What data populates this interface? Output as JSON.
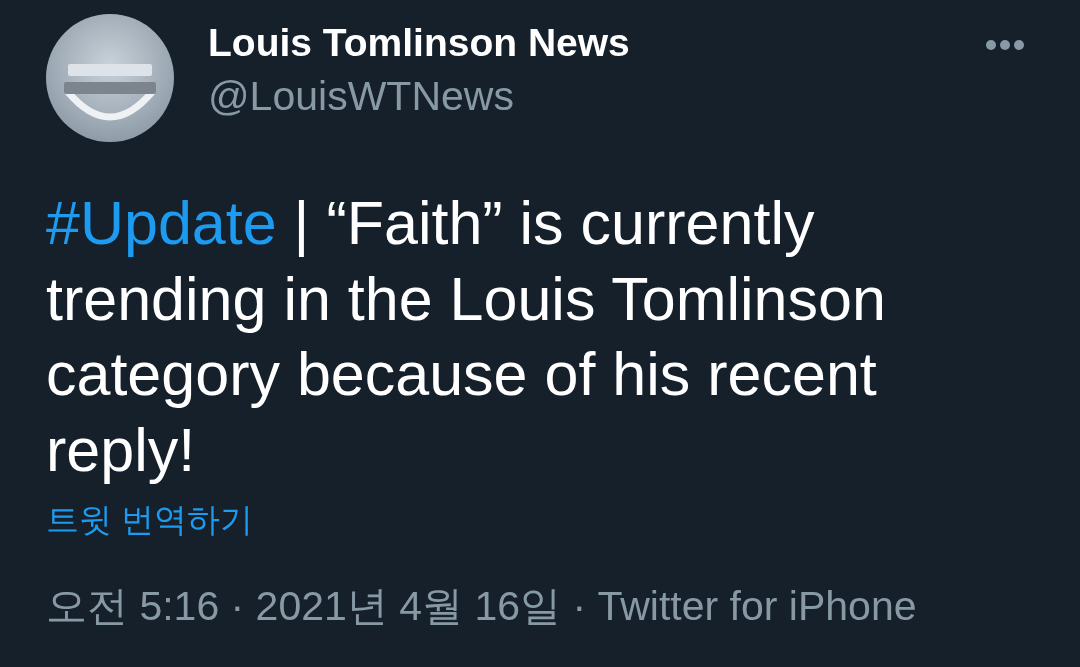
{
  "author": {
    "name": "Louis Tomlinson News",
    "handle": "@LouisWTNews"
  },
  "tweet": {
    "body": [
      {
        "kind": "hashtag",
        "text": "#Update"
      },
      {
        "kind": "plain",
        "text": " | “Faith” is currently trending in the Louis Tomlinson category because of his recent reply!"
      }
    ],
    "translate_link": "트윗 번역하기"
  },
  "meta": "오전 5:16 · 2021년 4월 16일 · Twitter for iPhone"
}
